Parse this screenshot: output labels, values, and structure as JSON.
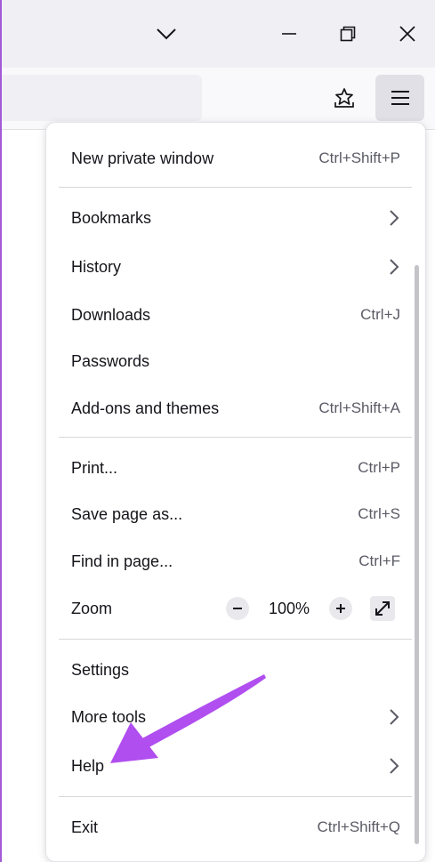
{
  "menu": {
    "new_private_window": {
      "label": "New private window",
      "shortcut": "Ctrl+Shift+P"
    },
    "bookmarks": {
      "label": "Bookmarks"
    },
    "history": {
      "label": "History"
    },
    "downloads": {
      "label": "Downloads",
      "shortcut": "Ctrl+J"
    },
    "passwords": {
      "label": "Passwords"
    },
    "addons": {
      "label": "Add-ons and themes",
      "shortcut": "Ctrl+Shift+A"
    },
    "print": {
      "label": "Print...",
      "shortcut": "Ctrl+P"
    },
    "save_page": {
      "label": "Save page as...",
      "shortcut": "Ctrl+S"
    },
    "find": {
      "label": "Find in page...",
      "shortcut": "Ctrl+F"
    },
    "zoom": {
      "label": "Zoom",
      "value": "100%"
    },
    "settings": {
      "label": "Settings"
    },
    "more_tools": {
      "label": "More tools"
    },
    "help": {
      "label": "Help"
    },
    "exit": {
      "label": "Exit",
      "shortcut": "Ctrl+Shift+Q"
    }
  },
  "icons": {
    "titlebar": [
      "chevron-down-icon",
      "minimize-icon",
      "restore-icon",
      "close-icon"
    ],
    "toolbar": [
      "bookmark-star-icon",
      "hamburger-menu-icon"
    ]
  },
  "colors": {
    "annotation_arrow": "#b04ef0",
    "hamburger_active": "#e0e0e6"
  }
}
